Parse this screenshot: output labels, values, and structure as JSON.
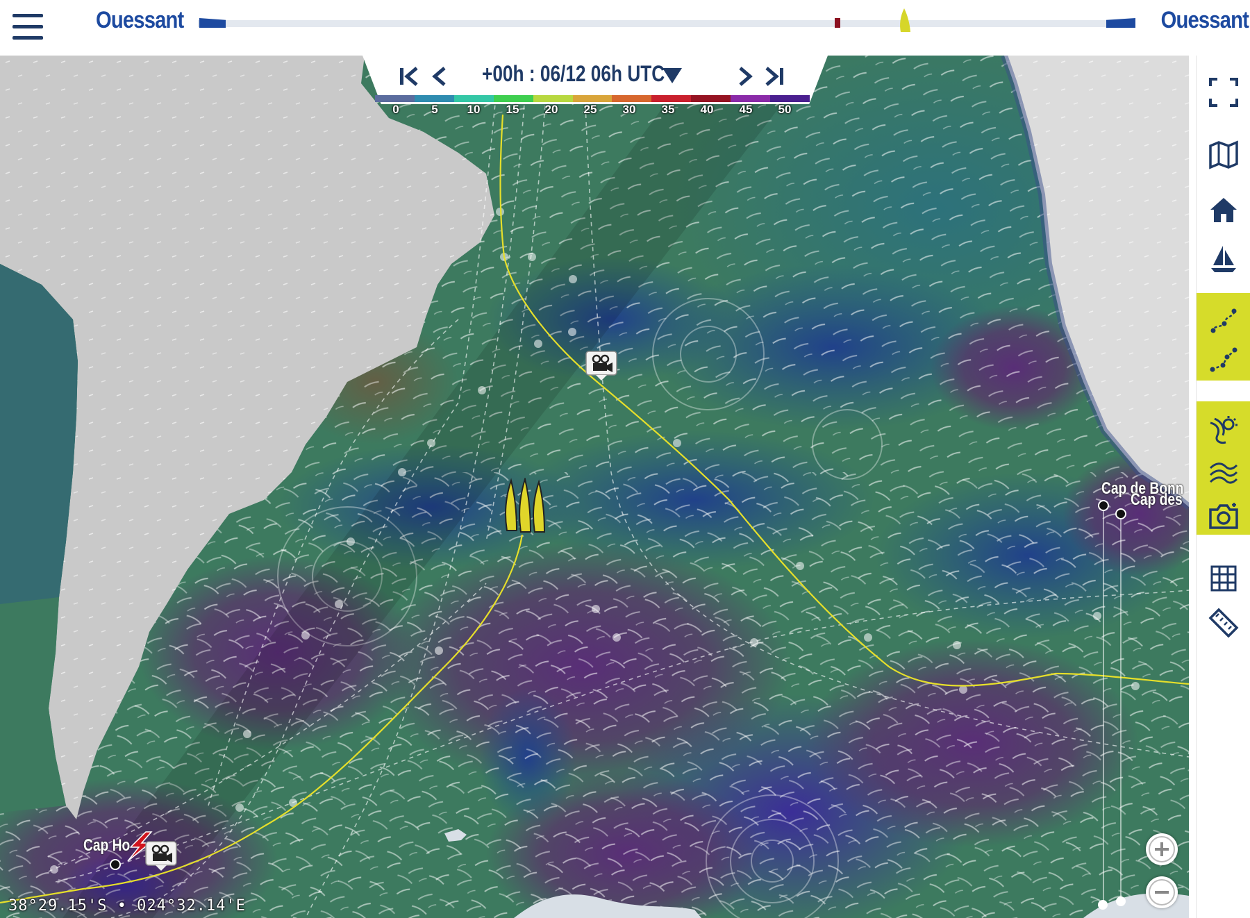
{
  "header": {
    "menu_icon": "hamburger-icon",
    "start_port": "Ouessant",
    "end_port": "Ouessant",
    "progress_colors": {
      "track": "#e3e8ef",
      "ends": "#1d4aa0",
      "marker": "#8b1020",
      "boat": "#d6d62a"
    }
  },
  "time_control": {
    "label": "+00h : 06/12 06h UTC",
    "first_icon": "skip-to-start-icon",
    "prev_icon": "chevron-left-icon",
    "dropdown_icon": "caret-down-icon",
    "next_icon": "chevron-right-icon",
    "last_icon": "skip-to-end-icon"
  },
  "wind_scale": {
    "labels": [
      "0",
      "5",
      "10",
      "15",
      "20",
      "25",
      "30",
      "35",
      "40",
      "45",
      "50"
    ],
    "colors": [
      "#5b6c9e",
      "#2f8cb0",
      "#34c7a6",
      "#3fcf50",
      "#b8d840",
      "#d9a53a",
      "#d7672e",
      "#c9202d",
      "#951322",
      "#8a2aa8",
      "#4a1f8f"
    ]
  },
  "map": {
    "labels": {
      "cap_horn": "Cap Ho",
      "cap_bonne_esperance": "Cap de Bonn",
      "cap_aiguilles": "Cap des"
    },
    "coordinates": "38°29.15'S • 024°32.14'E",
    "route_color": "#e6df2a"
  },
  "toolbar": {
    "items": [
      {
        "icon": "fullscreen-icon"
      },
      {
        "icon": "map-icon"
      },
      {
        "icon": "home-icon"
      },
      {
        "icon": "sailboat-icon"
      },
      {
        "icon": "route-curve-icon"
      },
      {
        "icon": "route-points-icon"
      },
      {
        "icon": "weather-icon"
      },
      {
        "icon": "wind-waves-icon"
      },
      {
        "icon": "camera-icon"
      },
      {
        "icon": "grid-icon"
      },
      {
        "icon": "ruler-icon"
      }
    ],
    "highlight_color": "#d6dc2a"
  },
  "zoom": {
    "in_icon": "zoom-in-icon",
    "out_icon": "zoom-out-icon"
  }
}
